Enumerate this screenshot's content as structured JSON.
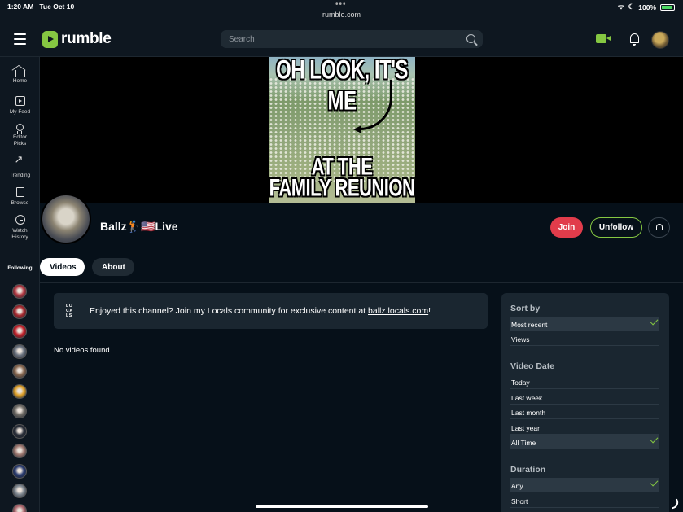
{
  "status_bar": {
    "time": "1:20 AM",
    "date": "Tue Oct 10",
    "url": "rumble.com",
    "battery": "100%"
  },
  "header": {
    "logo_text": "rumble",
    "search_placeholder": "Search"
  },
  "sidebar": {
    "items": [
      {
        "label": "Home",
        "icon": "home-icon"
      },
      {
        "label": "My Feed",
        "icon": "feed-icon"
      },
      {
        "label": "Editor Picks",
        "icon": "award-icon"
      },
      {
        "label": "Trending",
        "icon": "trending-icon"
      },
      {
        "label": "Browse",
        "icon": "browse-icon"
      },
      {
        "label": "Watch History",
        "icon": "history-icon"
      }
    ],
    "following_label": "Following",
    "following_colors": [
      "#b53a44",
      "#a82a30",
      "#c4222b",
      "#6c7480",
      "#8a6a52",
      "#e0a22a",
      "#74706a",
      "#2a2f39",
      "#a07a72",
      "#2a3c70",
      "#808890",
      "#b06a70"
    ]
  },
  "banner": {
    "caption_top": "OH LOOK, IT'S ME",
    "caption_bottom_1": "AT THE",
    "caption_bottom_2": "FAMILY REUNION"
  },
  "channel": {
    "name": "Ballz🏌️🇺🇸Live",
    "join_label": "Join",
    "unfollow_label": "Unfollow"
  },
  "tabs": [
    {
      "label": "Videos"
    },
    {
      "label": "About"
    }
  ],
  "locals": {
    "logo_line1": "LO",
    "logo_line2": "CA",
    "logo_line3": "LS",
    "text": "Enjoyed this channel? Join my Locals community for exclusive content at ",
    "link": "ballz.locals.com",
    "suffix": "!"
  },
  "empty_message": "No videos found",
  "filters": {
    "sort_by": {
      "heading": "Sort by",
      "options": [
        "Most recent",
        "Views"
      ],
      "selected": "Most recent"
    },
    "video_date": {
      "heading": "Video Date",
      "options": [
        "Today",
        "Last week",
        "Last month",
        "Last year",
        "All Time"
      ],
      "selected": "All Time"
    },
    "duration": {
      "heading": "Duration",
      "options": [
        "Any",
        "Short"
      ],
      "selected": "Any"
    }
  },
  "colors": {
    "accent_green": "#85c742",
    "join_red": "#e13c4b",
    "background": "#061019",
    "panel": "#1a2630"
  }
}
